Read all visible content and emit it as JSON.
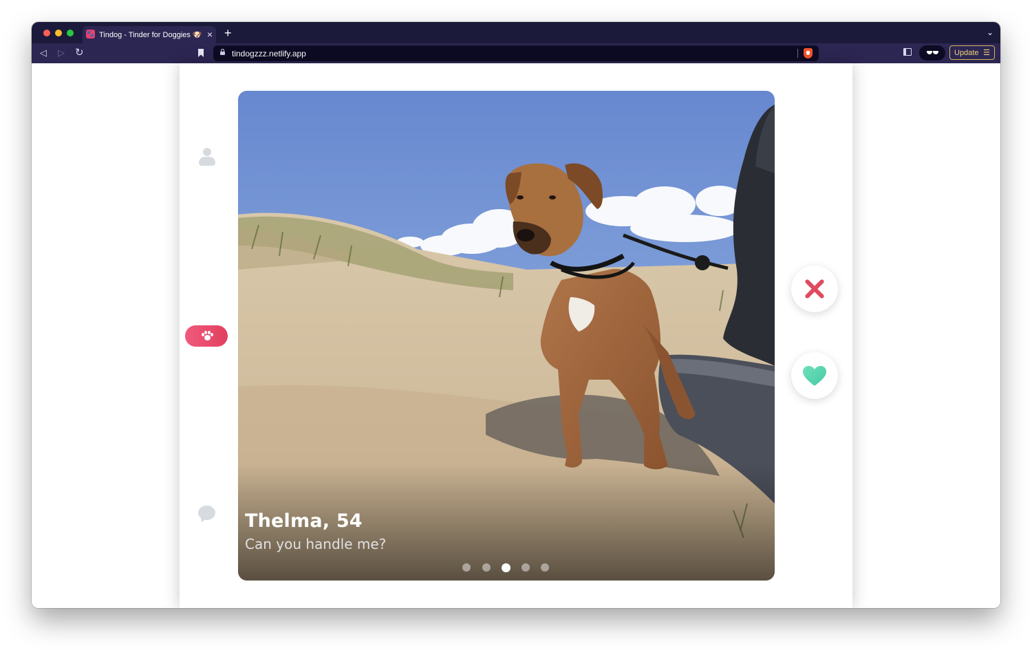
{
  "browser": {
    "tab_title": "Tindog - Tinder for Doggies 🐶",
    "tab_favicon": "🐾",
    "url": "tindogzzz.netlify.app",
    "update_label": "Update",
    "icons": [
      "back-icon",
      "forward-icon",
      "reload-icon",
      "bookmark-icon",
      "lock-icon",
      "brave-shield-icon",
      "sidebar-icon",
      "wallet-icon",
      "menu-icon"
    ]
  },
  "sidebar": {
    "items": [
      {
        "name": "profile",
        "icon": "user-icon"
      },
      {
        "name": "swipe",
        "icon": "paw-icon",
        "active": true
      },
      {
        "name": "messages",
        "icon": "chat-icon"
      }
    ]
  },
  "card": {
    "name": "Thelma, 54",
    "bio": "Can you handle me?",
    "photo_count": 5,
    "active_photo": 3
  },
  "actions": {
    "nope_icon": "close-icon",
    "like_icon": "heart-icon"
  },
  "colors": {
    "accent": "#e5426a",
    "nope": "#e04a5f",
    "like": "#5ad8b3",
    "browser_bg": "#1c1a3a"
  }
}
